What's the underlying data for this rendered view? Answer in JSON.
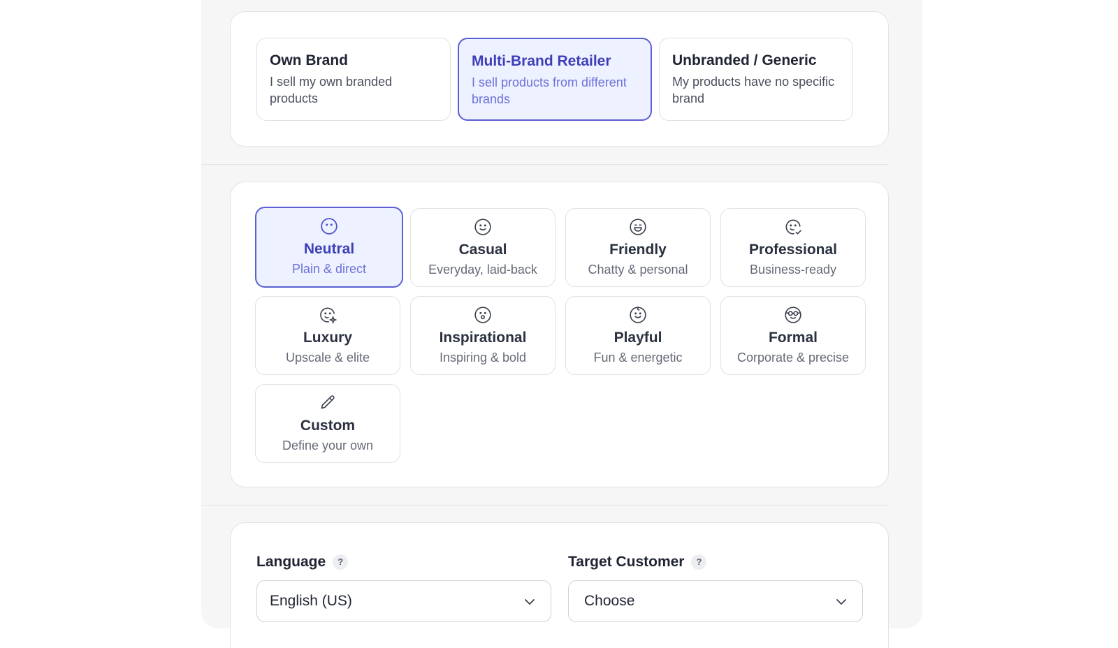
{
  "brand_types": [
    {
      "title": "Own Brand",
      "desc": "I sell my own branded products",
      "selected": false
    },
    {
      "title": "Multi-Brand Retailer",
      "desc": "I sell products from different brands",
      "selected": true
    },
    {
      "title": "Unbranded / Generic",
      "desc": "My products have no specific brand",
      "selected": false
    }
  ],
  "tones": [
    {
      "title": "Neutral",
      "desc": "Plain & direct",
      "icon": "neutral-face-icon",
      "selected": true
    },
    {
      "title": "Casual",
      "desc": "Everyday, laid-back",
      "icon": "smile-face-icon",
      "selected": false
    },
    {
      "title": "Friendly",
      "desc": "Chatty & personal",
      "icon": "grin-face-icon",
      "selected": false
    },
    {
      "title": "Professional",
      "desc": "Business-ready",
      "icon": "face-check-icon",
      "selected": false
    },
    {
      "title": "Luxury",
      "desc": "Upscale & elite",
      "icon": "face-sparkle-icon",
      "selected": false
    },
    {
      "title": "Inspirational",
      "desc": "Inspiring & bold",
      "icon": "amazed-face-icon",
      "selected": false
    },
    {
      "title": "Playful",
      "desc": "Fun & energetic",
      "icon": "playful-face-icon",
      "selected": false
    },
    {
      "title": "Formal",
      "desc": "Corporate & precise",
      "icon": "glasses-face-icon",
      "selected": false
    },
    {
      "title": "Custom",
      "desc": "Define your own",
      "icon": "pencil-icon",
      "selected": false
    }
  ],
  "language": {
    "label": "Language",
    "help": "?",
    "value": "English (US)"
  },
  "target_customer": {
    "label": "Target Customer",
    "help": "?",
    "value": "Choose"
  },
  "colors": {
    "accent": "#5b5fd6",
    "accent_text": "#3d3fb8",
    "selected_bg": "#eef1ff"
  }
}
